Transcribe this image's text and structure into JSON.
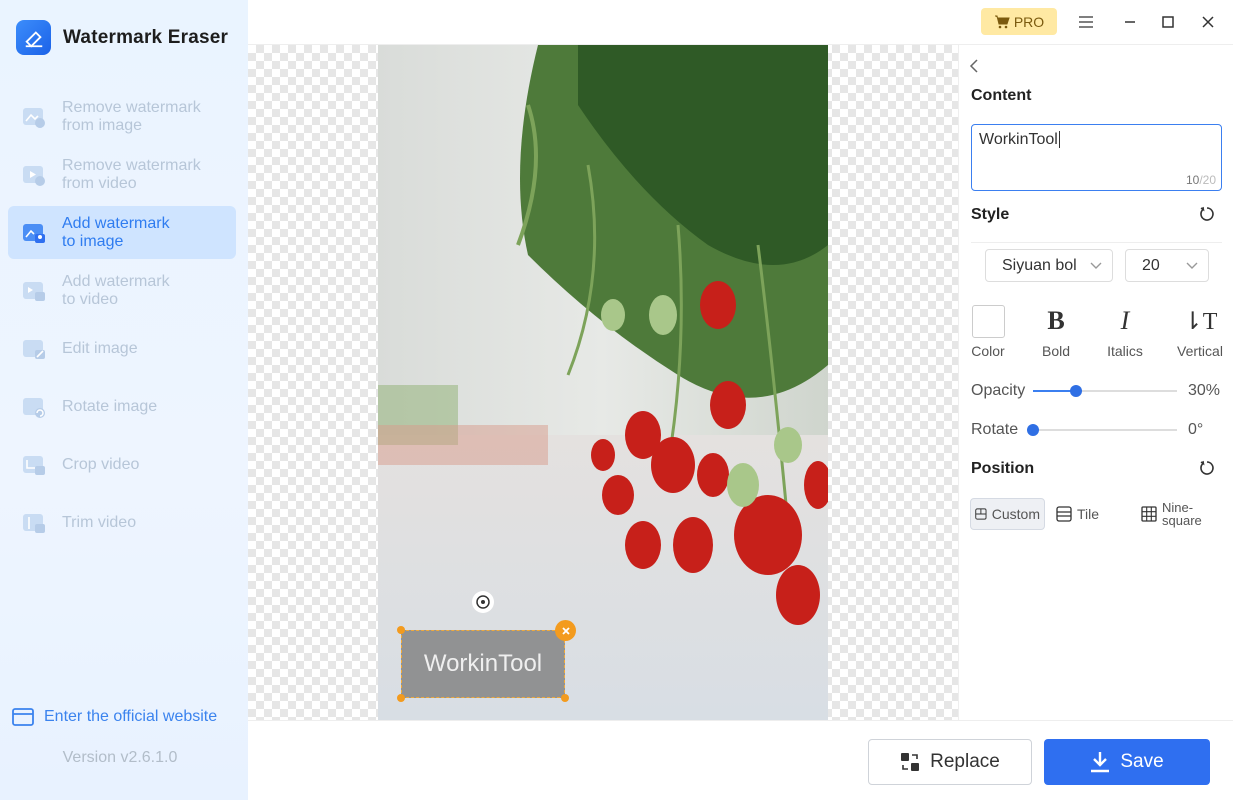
{
  "app": {
    "name": "Watermark Eraser",
    "version": "Version v2.6.1.0"
  },
  "sidebar": {
    "items": [
      {
        "line1": "Remove watermark",
        "line2": "from image",
        "icon": "image-icon",
        "active": false
      },
      {
        "line1": "Remove watermark",
        "line2": "from video",
        "icon": "video-icon",
        "active": false
      },
      {
        "line1": "Add watermark",
        "line2": "to image",
        "icon": "image-add-icon",
        "active": true
      },
      {
        "line1": "Add watermark",
        "line2": "to video",
        "icon": "video-add-icon",
        "active": false
      },
      {
        "line1": "Edit image",
        "line2": "",
        "icon": "edit-image-icon",
        "active": false
      },
      {
        "line1": "Rotate image",
        "line2": "",
        "icon": "rotate-image-icon",
        "active": false
      },
      {
        "line1": "Crop video",
        "line2": "",
        "icon": "crop-video-icon",
        "active": false
      },
      {
        "line1": "Trim video",
        "line2": "",
        "icon": "trim-video-icon",
        "active": false
      }
    ],
    "official_link": "Enter the official website"
  },
  "titlebar": {
    "pro_label": "PRO"
  },
  "canvas": {
    "watermark_text": "WorkinTool"
  },
  "panel": {
    "content_title": "Content",
    "content_value": "WorkinTool",
    "char_count": "10",
    "char_max": "/20",
    "style_title": "Style",
    "font": "Siyuan bol",
    "size": "20",
    "tools": {
      "color": "Color",
      "bold": "Bold",
      "italics": "Italics",
      "vertical": "Vertical"
    },
    "opacity_label": "Opacity",
    "opacity_value": "30%",
    "opacity_level": 0.3,
    "rotate_label": "Rotate",
    "rotate_value": "0°",
    "rotate_level": 0,
    "position_title": "Position",
    "position": {
      "custom": "Custom",
      "tile": "Tile",
      "nine_line1": "Nine-",
      "nine_line2": "square"
    }
  },
  "footer": {
    "replace_label": "Replace",
    "save_label": "Save"
  },
  "colors": {
    "accent": "#2f6ff0",
    "pro_bg": "#ffe9a3",
    "handle": "#f39b1e"
  }
}
